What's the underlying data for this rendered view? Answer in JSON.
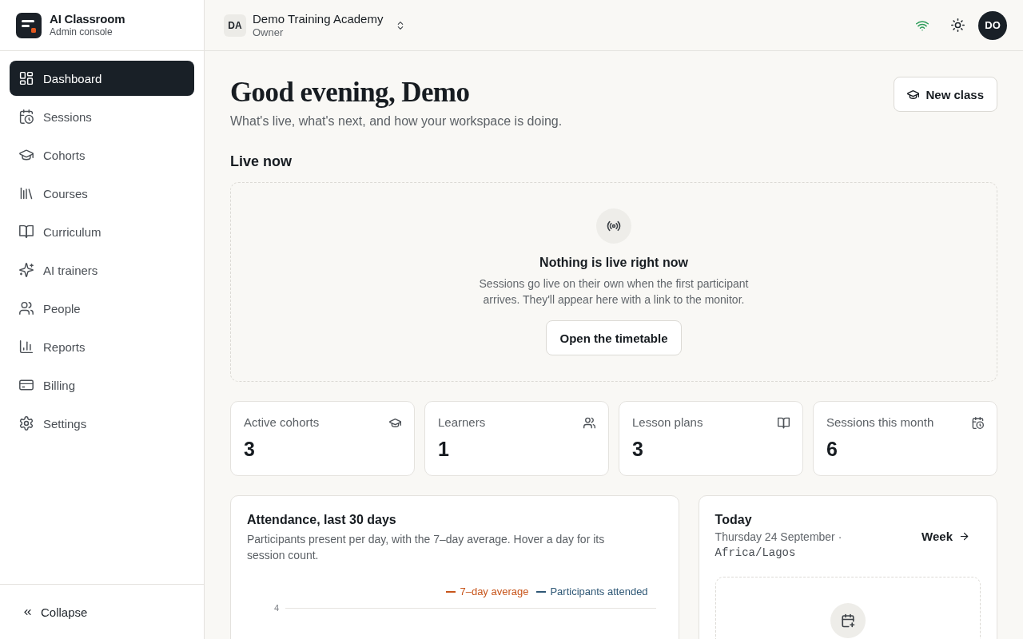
{
  "brand": {
    "name": "AI Classroom",
    "subtitle": "Admin console"
  },
  "sidebar": {
    "items": [
      {
        "label": "Dashboard",
        "selected": true
      },
      {
        "label": "Sessions",
        "selected": false
      },
      {
        "label": "Cohorts",
        "selected": false
      },
      {
        "label": "Courses",
        "selected": false
      },
      {
        "label": "Curriculum",
        "selected": false
      },
      {
        "label": "AI trainers",
        "selected": false
      },
      {
        "label": "People",
        "selected": false
      },
      {
        "label": "Reports",
        "selected": false
      },
      {
        "label": "Billing",
        "selected": false
      },
      {
        "label": "Settings",
        "selected": false
      }
    ],
    "collapse": "Collapse"
  },
  "header": {
    "workspace": {
      "initials": "DA",
      "name": "Demo Training Academy",
      "role": "Owner"
    },
    "connection": {
      "online": true
    },
    "avatar": "DO"
  },
  "page": {
    "title": "Good evening, Demo",
    "subtitle": "What's live, what's next, and how your workspace is doing.",
    "primary_action": "New class"
  },
  "live": {
    "heading": "Live now",
    "empty_title": "Nothing is live right now",
    "empty_text": "Sessions go live on their own when the first participant arrives. They'll appear here with a link to the monitor.",
    "action": "Open the timetable"
  },
  "stats": [
    {
      "label": "Active cohorts",
      "value": "3"
    },
    {
      "label": "Learners",
      "value": "1"
    },
    {
      "label": "Lesson plans",
      "value": "3"
    },
    {
      "label": "Sessions this month",
      "value": "6"
    }
  ],
  "attendance": {
    "title": "Attendance, last 30 days",
    "description": "Participants present per day, with the 7–day average. Hover a day for its session count.",
    "legend": [
      {
        "label": "7–day average",
        "color": "#c8561c"
      },
      {
        "label": "Participants attended",
        "color": "#2f5876"
      }
    ],
    "y_tick": "4"
  },
  "today": {
    "title": "Today",
    "date": "Thursday 24 September ·",
    "timezone": "Africa/Lagos",
    "link": "Week"
  }
}
